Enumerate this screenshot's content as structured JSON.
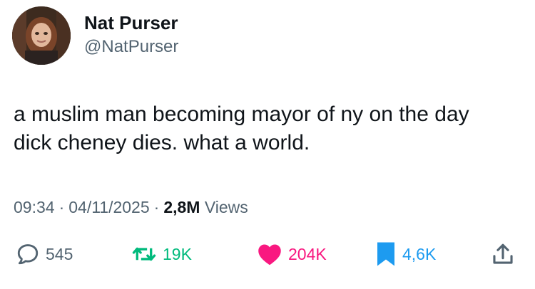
{
  "author": {
    "display_name": "Nat Purser",
    "handle": "@NatPurser"
  },
  "tweet": {
    "text": "a muslim man becoming mayor of ny on the day dick cheney dies. what a world.",
    "time": "09:34",
    "date": "04/11/2025",
    "views_count": "2,8M",
    "views_label": "Views"
  },
  "actions": {
    "replies": "545",
    "retweets": "19K",
    "likes": "204K",
    "bookmarks": "4,6K"
  },
  "icons": {
    "reply": "speech-bubble-icon",
    "retweet": "retweet-arrows-icon",
    "like": "heart-icon",
    "bookmark": "bookmark-icon",
    "share": "share-upload-icon"
  },
  "colors": {
    "text": "#0f1419",
    "secondary": "#536471",
    "retweet": "#00ba7c",
    "like": "#f91880",
    "bookmark": "#1d9bf0"
  }
}
